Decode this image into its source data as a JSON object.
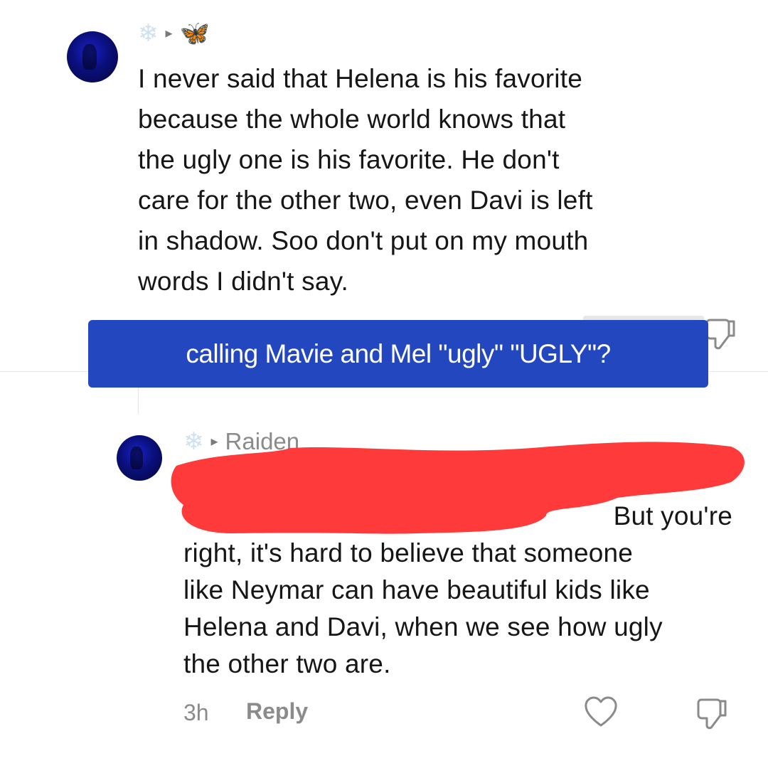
{
  "comment1": {
    "avatar_icon": "user-avatar",
    "badge_left": "❄",
    "caret": "▸",
    "badge_right": "🦋",
    "lines": [
      "I never said that Helena is his favorite",
      "because the whole world knows that",
      "the ugly one is his favorite. He don't",
      "care for the other two, even Davi is left",
      "in shadow. Soo don't put on my mouth",
      "words I didn't say."
    ]
  },
  "banner": {
    "text": "calling Mavie and Mel \"ugly\" \"UGLY\"?",
    "color": "#2347be"
  },
  "comment2": {
    "avatar_icon": "user-avatar",
    "badge_left": "❄",
    "caret": "▸",
    "username": "Raiden",
    "line1_visible": "But you're",
    "lines": [
      "right, it's hard to believe that someone",
      "like Neymar can have beautiful kids like",
      "Helena and Davi, when we see how ugly",
      "the other two are."
    ],
    "redaction_color": "#ff3a3a",
    "time": "3h",
    "reply_label": "Reply",
    "like_icon": "heart-icon",
    "dislike_icon": "thumbs-down-icon"
  }
}
